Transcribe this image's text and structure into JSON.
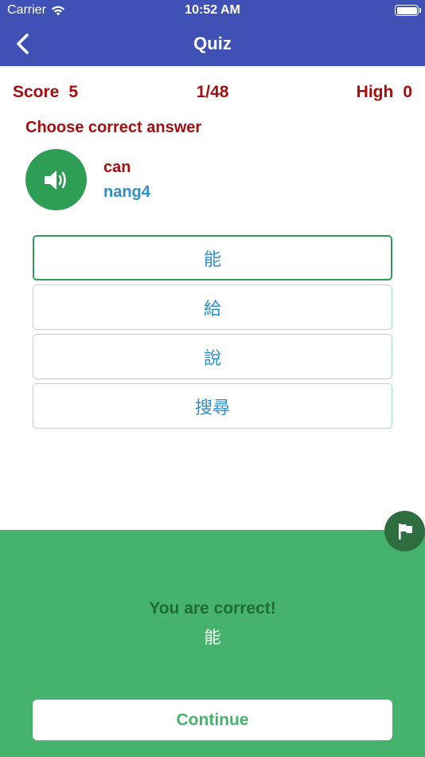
{
  "status_bar": {
    "carrier": "Carrier",
    "time": "10:52 AM"
  },
  "nav": {
    "title": "Quiz"
  },
  "score": {
    "score_label": "Score",
    "score_value": "5",
    "progress": "1/48",
    "high_label": "High",
    "high_value": "0"
  },
  "question": {
    "instruction": "Choose correct answer",
    "english": "can",
    "pinyin": "nang4"
  },
  "options": [
    {
      "label": "能",
      "state": "correct"
    },
    {
      "label": "給",
      "state": "normal"
    },
    {
      "label": "說",
      "state": "normal"
    },
    {
      "label": "搜尋",
      "state": "normal"
    }
  ],
  "result": {
    "message": "You are correct!",
    "answer": "能",
    "continue_label": "Continue"
  },
  "icons": {
    "back": "chevron-left-icon",
    "speaker": "speaker-icon",
    "flag": "flag-icon",
    "wifi": "wifi-icon",
    "battery": "battery-icon"
  },
  "colors": {
    "nav": "#3f51b5",
    "accent_red": "#a50e0e",
    "accent_blue": "#2b8fc8",
    "green": "#45b36b",
    "dark_green": "#2e6d3e"
  }
}
